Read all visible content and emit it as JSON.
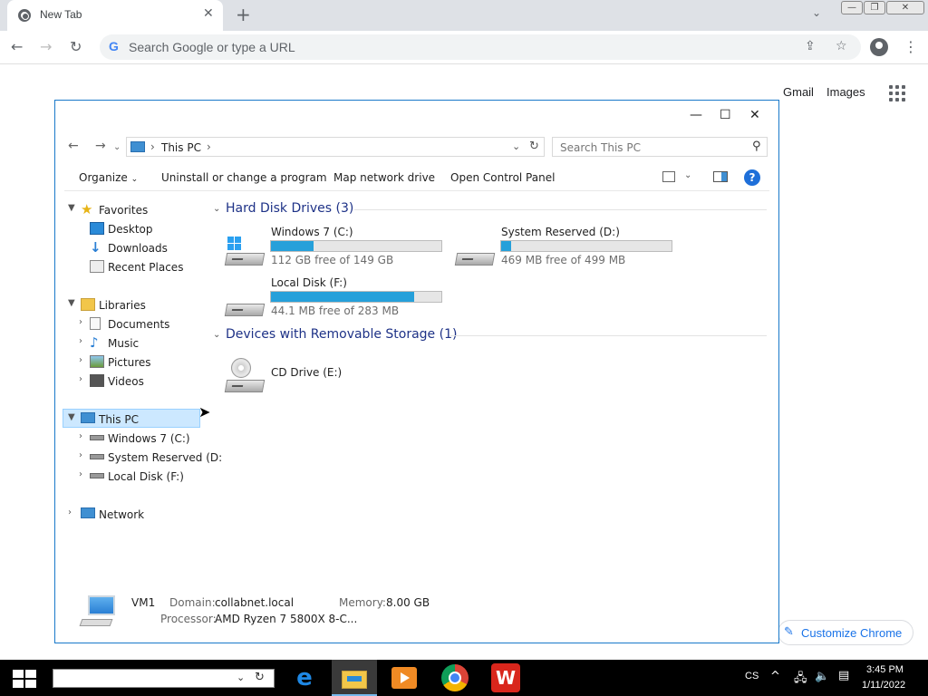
{
  "browser": {
    "tab_title": "New Tab",
    "omnibox_placeholder": "Search Google or type a URL",
    "links": {
      "gmail": "Gmail",
      "images": "Images"
    },
    "customize_label": "Customize Chrome"
  },
  "explorer": {
    "address": "This PC",
    "search_placeholder": "Search This PC",
    "commands": {
      "organize": "Organize",
      "uninstall": "Uninstall or change a program",
      "map_drive": "Map network drive",
      "control_panel": "Open Control Panel"
    },
    "nav": {
      "favorites": "Favorites",
      "desktop": "Desktop",
      "downloads": "Downloads",
      "recent": "Recent Places",
      "libraries": "Libraries",
      "documents": "Documents",
      "music": "Music",
      "pictures": "Pictures",
      "videos": "Videos",
      "this_pc": "This PC",
      "drive_c": "Windows 7 (C:)",
      "drive_d": "System Reserved (D:",
      "drive_f": "Local Disk (F:)",
      "network": "Network"
    },
    "groups": {
      "hdd": "Hard Disk Drives (3)",
      "removable": "Devices with Removable Storage (1)"
    },
    "drives": [
      {
        "name": "Windows 7 (C:)",
        "free": "112 GB free of 149 GB",
        "used_fraction": 0.25
      },
      {
        "name": "System Reserved (D:)",
        "free": "469 MB free of 499 MB",
        "used_fraction": 0.06
      },
      {
        "name": "Local Disk (F:)",
        "free": "44.1 MB free of 283 MB",
        "used_fraction": 0.84
      }
    ],
    "cd_drive": "CD Drive (E:)",
    "details": {
      "name": "VM1",
      "domain_label": "Domain:",
      "domain": "collabnet.local",
      "memory_label": "Memory:",
      "memory": "8.00 GB",
      "processor_label": "Processor:",
      "processor": "AMD Ryzen 7 5800X 8-C..."
    }
  },
  "taskbar": {
    "language": "CS",
    "time": "3:45 PM",
    "date": "1/11/2022"
  },
  "colors": {
    "accent": "#26a0da",
    "selection": "#cce8ff",
    "window_border": "#1979ca"
  }
}
